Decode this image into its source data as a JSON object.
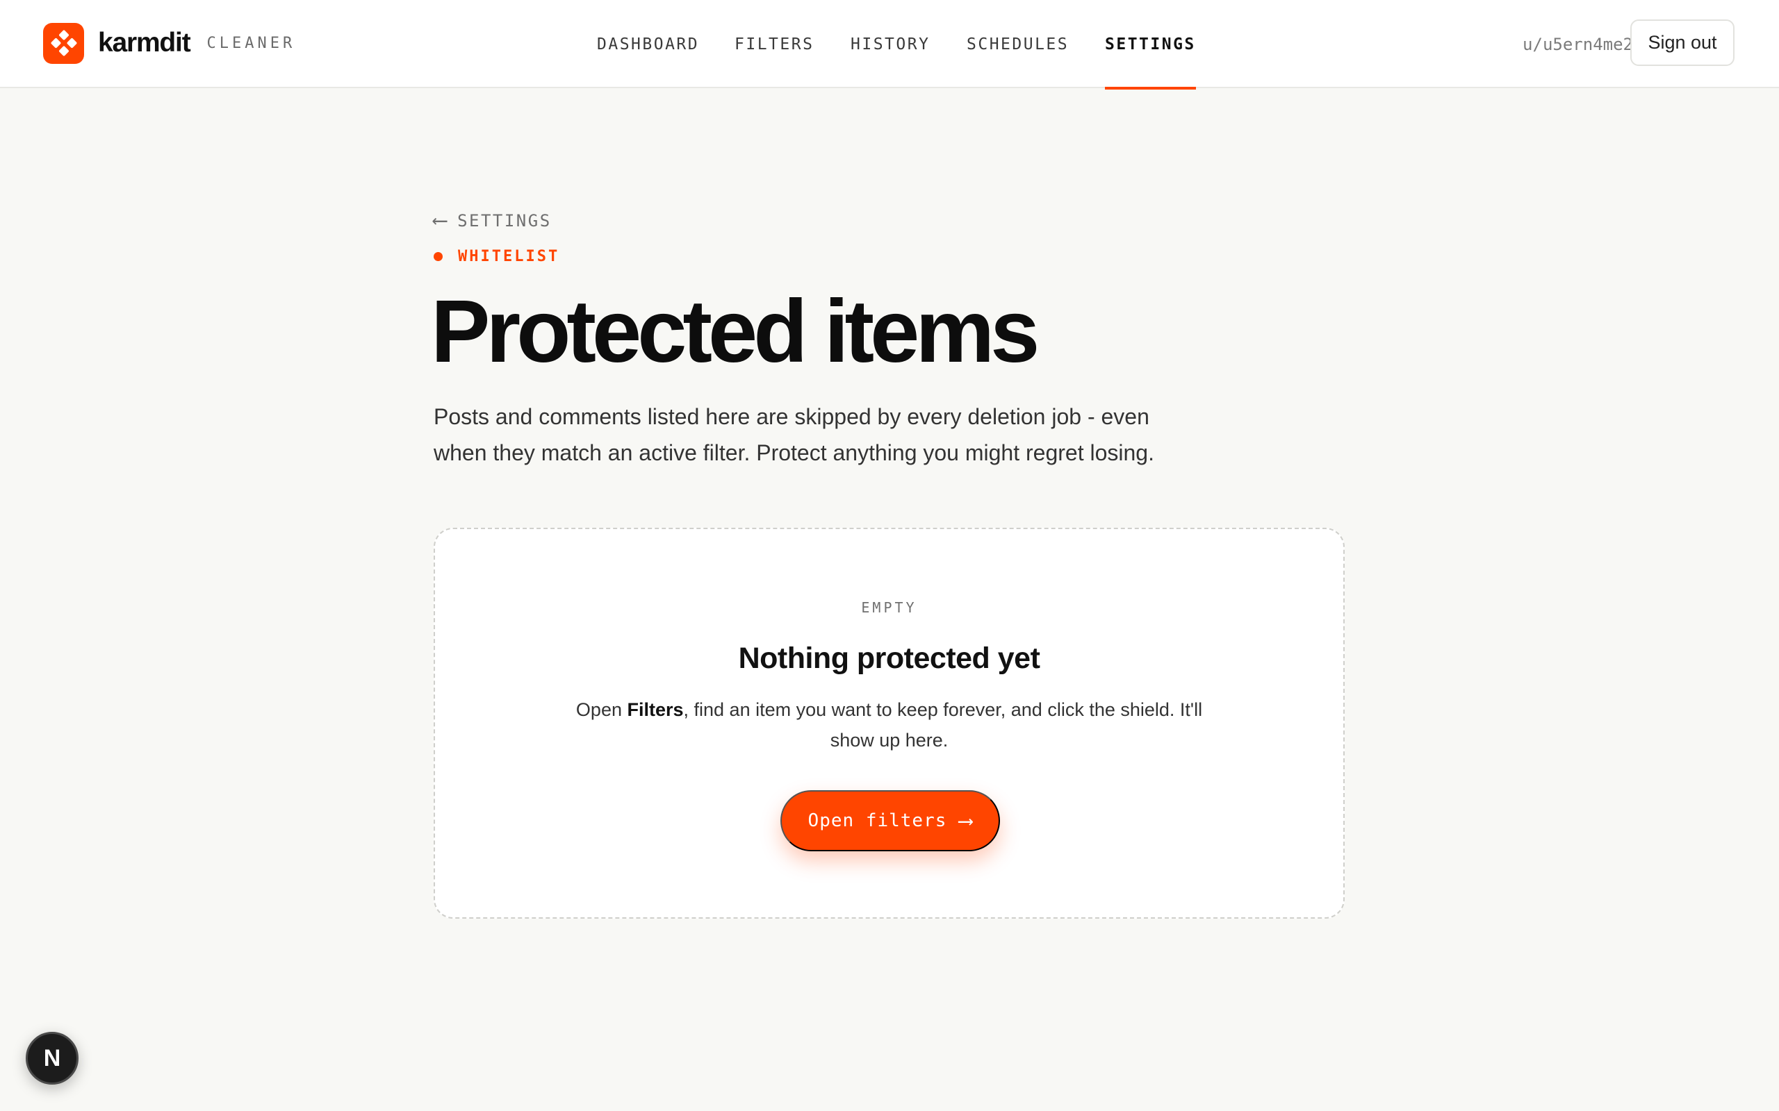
{
  "header": {
    "brand_name": "karmdit",
    "brand_sub": "CLEANER",
    "nav": [
      {
        "label": "DASHBOARD"
      },
      {
        "label": "FILTERS"
      },
      {
        "label": "HISTORY"
      },
      {
        "label": "SCHEDULES"
      },
      {
        "label": "SETTINGS"
      }
    ],
    "active_nav": "SETTINGS",
    "username": "u/u5ern4me2",
    "signout_label": "Sign out"
  },
  "main": {
    "back_label": "SETTINGS",
    "kicker": "WHITELIST",
    "title": "Protected items",
    "lead": "Posts and comments listed here are skipped by every deletion job - even when they match an active filter. Protect anything you might regret losing.",
    "empty": {
      "label": "EMPTY",
      "title": "Nothing protected yet",
      "text_before": "Open ",
      "text_bold": "Filters",
      "text_after": ", find an item you want to keep forever, and click the shield. It'll show up here.",
      "cta_label": "Open filters"
    }
  },
  "dev_badge": "N",
  "colors": {
    "accent": "#ff4500",
    "background": "#f8f8f5",
    "surface": "#ffffff"
  },
  "icons": {
    "logo": "karmdit-logo-icon",
    "back": "arrow-left-icon",
    "kicker": "dot-icon",
    "cta": "arrow-right-icon"
  }
}
